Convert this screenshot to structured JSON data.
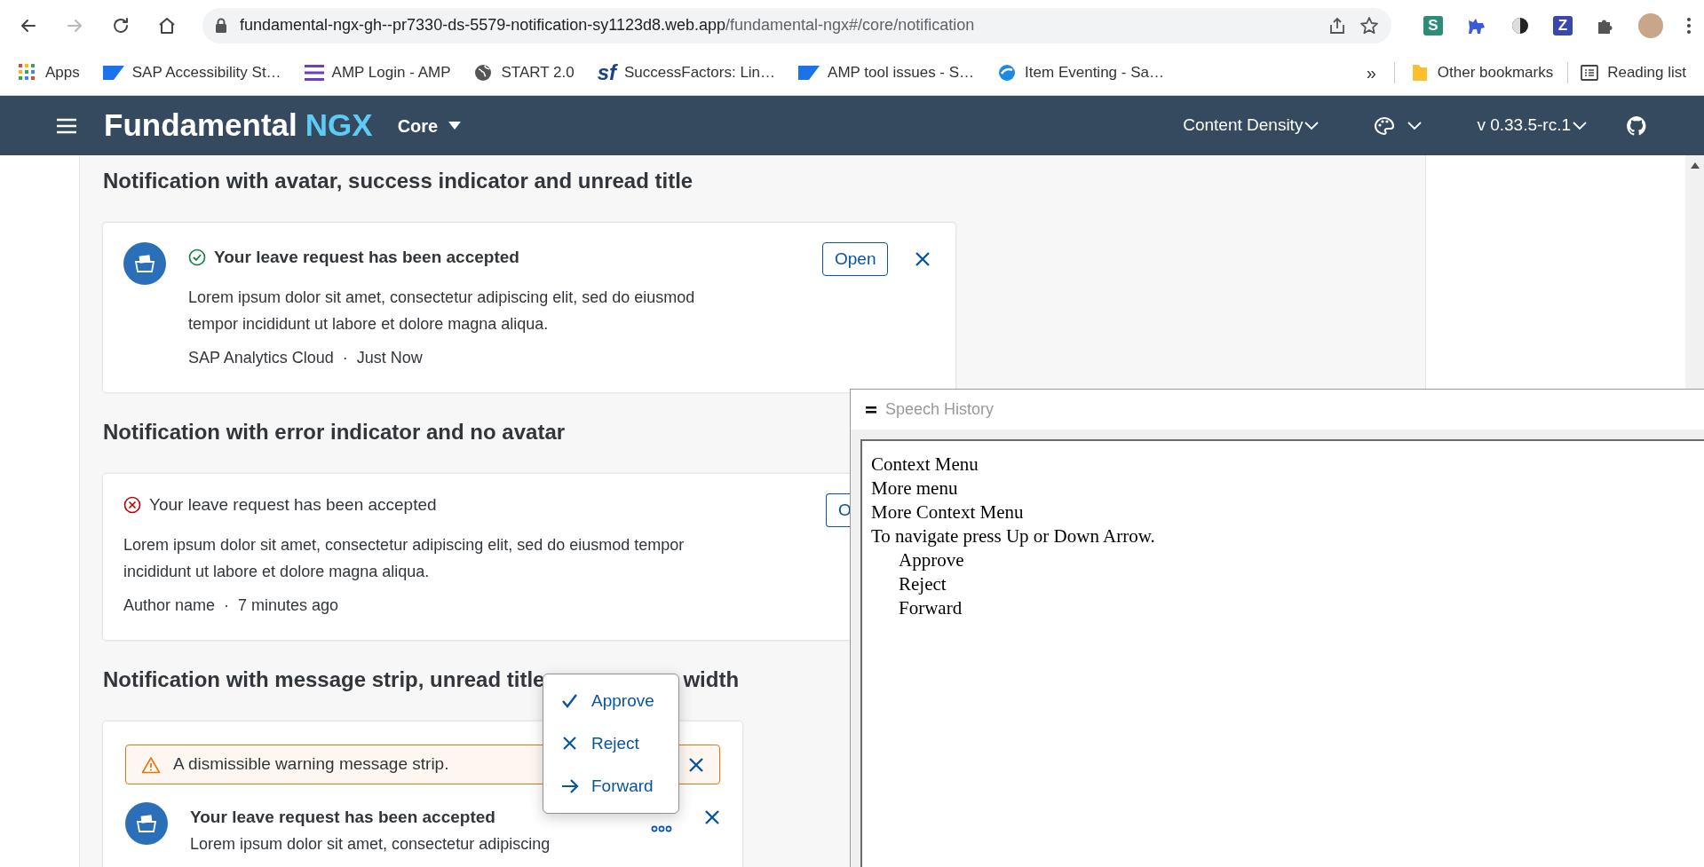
{
  "browser": {
    "nav_buttons": [
      {
        "kind": "back",
        "disabled": false
      },
      {
        "kind": "forward",
        "disabled": true
      },
      {
        "kind": "reload",
        "disabled": false
      },
      {
        "kind": "home",
        "disabled": false
      }
    ],
    "url_host": "fundamental-ngx-gh--pr7330-ds-5579-notification-sy1123d8.web.app",
    "url_path": "/fundamental-ngx#/core/notification",
    "extensions": [
      {
        "kind": "letter",
        "label": "S",
        "color": "#2e8b78"
      },
      {
        "kind": "dog"
      },
      {
        "kind": "contrast"
      },
      {
        "kind": "letter",
        "label": "Z",
        "color": "#3949ab"
      },
      {
        "kind": "puzzle"
      }
    ]
  },
  "bookmarks": {
    "items": [
      {
        "kind": "apps",
        "label": "Apps"
      },
      {
        "kind": "sap",
        "label": "SAP Accessibility St…"
      },
      {
        "kind": "lines",
        "label": "AMP Login - AMP"
      },
      {
        "kind": "globe",
        "label": "START 2.0"
      },
      {
        "kind": "sf",
        "icon_text": "sf",
        "label": "SuccessFactors: Lin…"
      },
      {
        "kind": "sap",
        "label": "AMP tool issues - S…"
      },
      {
        "kind": "orb",
        "label": "Item Eventing - Sa…"
      }
    ],
    "overflow": "»",
    "other": "Other bookmarks",
    "reading_list": "Reading list"
  },
  "app_header": {
    "brand": "Fundamental",
    "brand_accent": "NGX",
    "product": "Core",
    "menus": [
      {
        "kind": "text",
        "label": "Content Density"
      },
      {
        "kind": "theme"
      },
      {
        "kind": "text",
        "label": "v 0.33.5-rc.1"
      }
    ]
  },
  "sections": [
    {
      "heading_parts": [
        "Notification with avatar, success indicator and unread title"
      ],
      "notification": {
        "avatar": true,
        "indicator": {
          "kind": "success"
        },
        "unread": true,
        "title": "Your leave request has been accepted",
        "body": "Lorem ipsum dolor sit amet, consectetur adipiscing elit, sed do eiusmod tempor incididunt ut labore et dolore magna aliqua.",
        "meta": [
          "SAP Analytics Cloud",
          "Just Now"
        ],
        "meta_separator": "·",
        "action": {
          "kind": "button",
          "label": "Open"
        },
        "closable": true
      }
    },
    {
      "heading_parts": [
        "Notification with error indicator and no avatar"
      ],
      "notification": {
        "avatar": false,
        "indicator": {
          "kind": "error"
        },
        "unread": false,
        "title": "Your leave request has been accepted",
        "body": "Lorem ipsum dolor sit amet, consectetur adipiscing elit, sed do eiusmod tempor incididunt ut labore et dolore magna aliqua.",
        "meta": [
          "Author name",
          "7 minutes ago"
        ],
        "meta_separator": "·",
        "action": {
          "kind": "button",
          "label": "O"
        },
        "closable": false
      }
    },
    {
      "heading_parts": [
        "Notification with message strip, unread title",
        "width"
      ],
      "notification": {
        "message_strip": {
          "kind": "warning",
          "text": "A dismissible warning message strip."
        },
        "avatar": true,
        "unread": true,
        "title": "Your leave request has been accepted",
        "body": "Lorem ipsum dolor sit amet, consectetur adipiscing",
        "action": {
          "kind": "more"
        },
        "closable": true
      }
    }
  ],
  "context_menu": [
    {
      "kind": "check",
      "label": "Approve"
    },
    {
      "kind": "cross",
      "label": "Reject"
    },
    {
      "kind": "arrow",
      "label": "Forward"
    }
  ],
  "speech_history": {
    "title": "Speech History",
    "lines": [
      {
        "text": "Context Menu"
      },
      {
        "text": "More menu"
      },
      {
        "text": "More Context Menu"
      },
      {
        "text": "To navigate press Up or Down Arrow.",
        "children": [
          {
            "text": "Approve"
          },
          {
            "text": "Reject"
          },
          {
            "text": "Forward"
          }
        ]
      }
    ]
  }
}
